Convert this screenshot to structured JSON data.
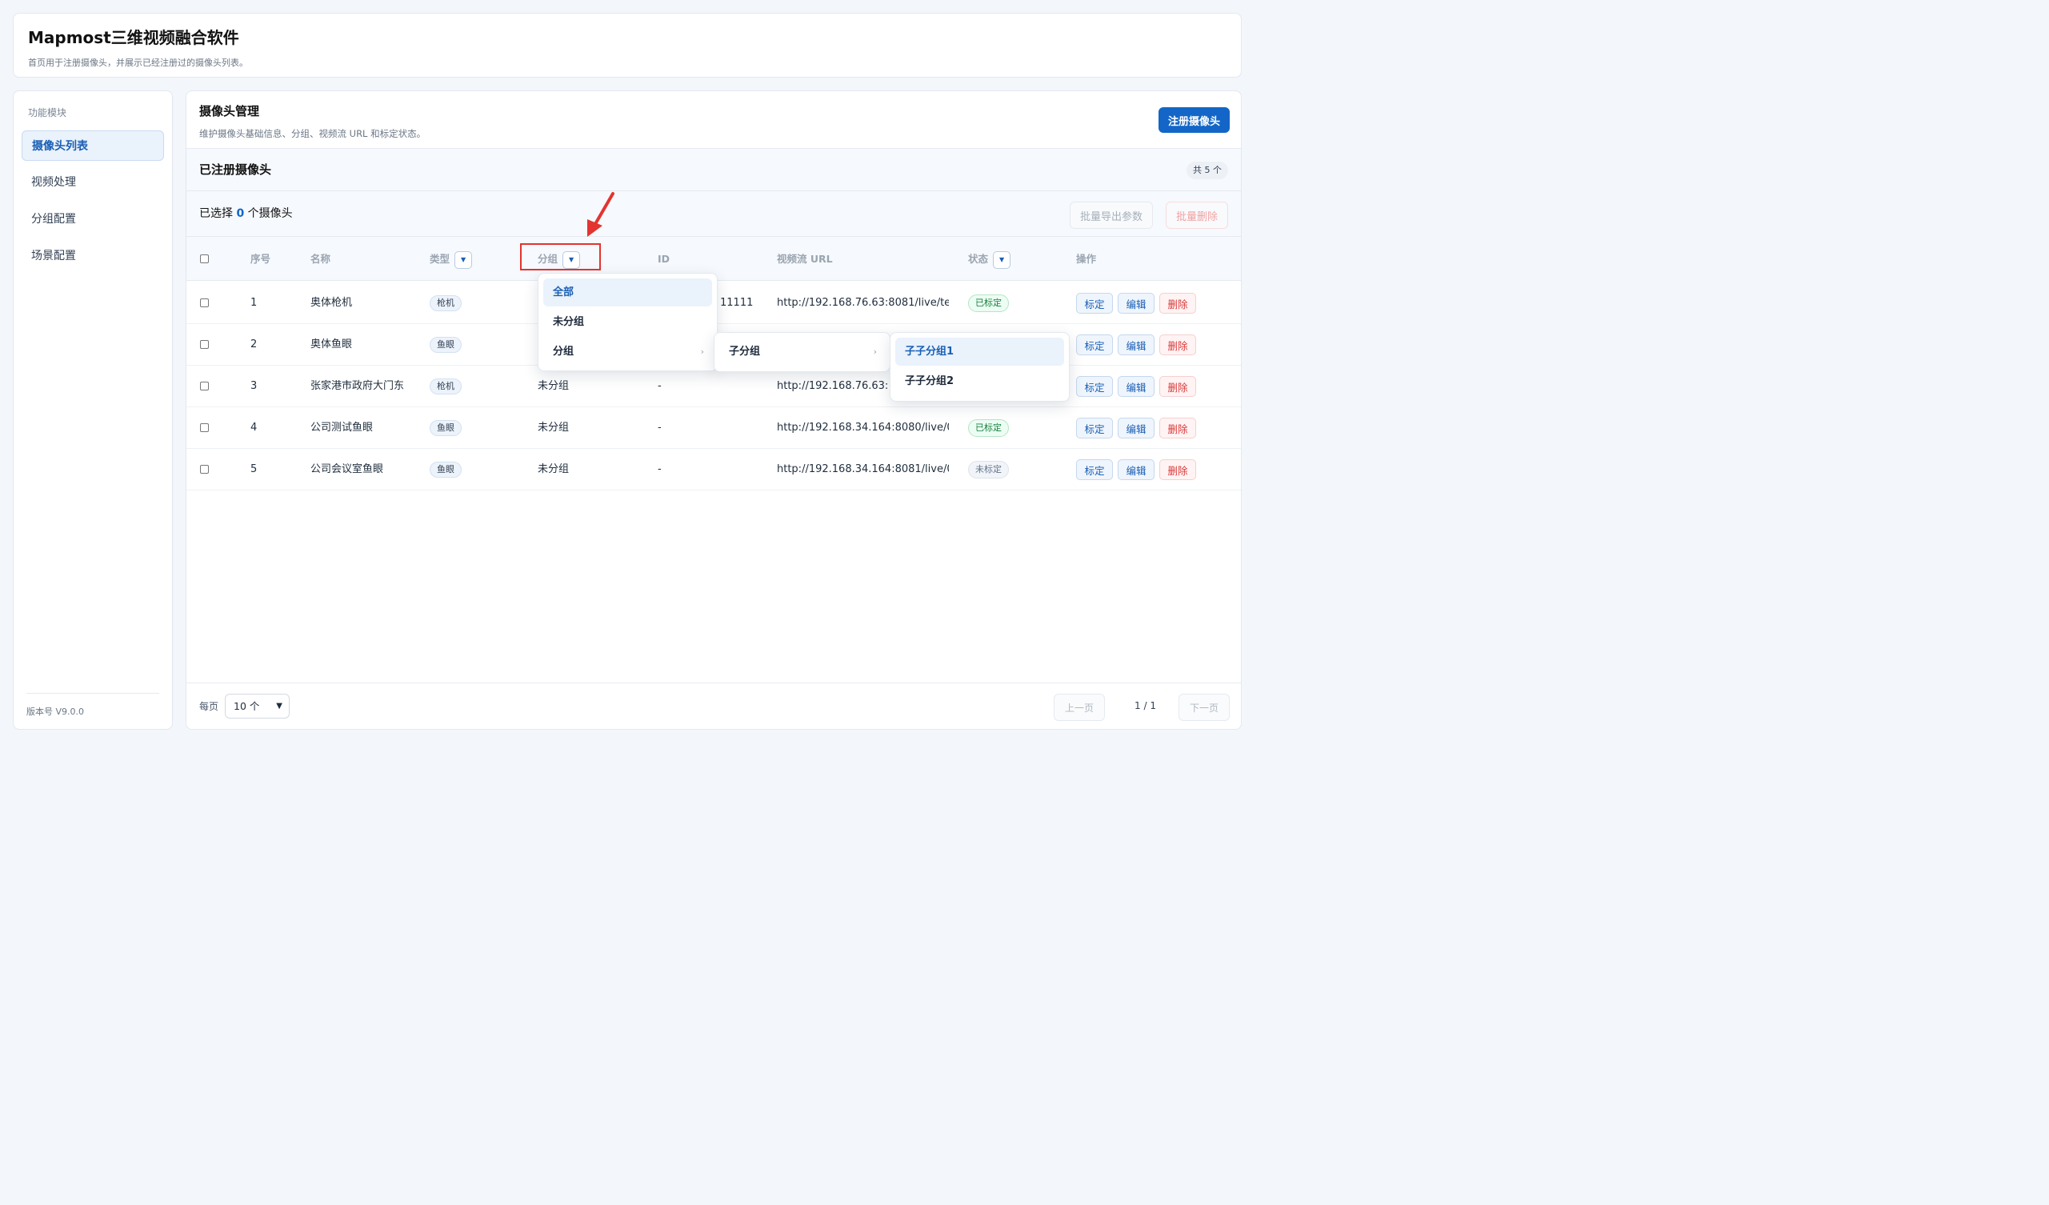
{
  "app": {
    "title": "Mapmost三维视频融合软件",
    "subtitle": "首页用于注册摄像头，并展示已经注册过的摄像头列表。"
  },
  "sidebar": {
    "title": "功能模块",
    "items": [
      {
        "label": "摄像头列表"
      },
      {
        "label": "视频处理"
      },
      {
        "label": "分组配置"
      },
      {
        "label": "场景配置"
      }
    ],
    "version": "版本号 V9.0.0"
  },
  "panel": {
    "title": "摄像头管理",
    "description": "维护摄像头基础信息、分组、视频流 URL 和标定状态。",
    "register_button": "注册摄像头"
  },
  "list": {
    "title": "已注册摄像头",
    "total": "共 5 个",
    "selected_prefix": "已选择",
    "selected_count": "0",
    "selected_suffix": "个摄像头",
    "export_button": "批量导出参数",
    "batch_delete_button": "批量删除"
  },
  "table": {
    "headers": {
      "index": "序号",
      "name": "名称",
      "type": "类型",
      "group": "分组",
      "id": "ID",
      "url": "视频流 URL",
      "status": "状态",
      "actions": "操作"
    },
    "action_labels": {
      "calibrate": "标定",
      "edit": "编辑",
      "delete": "删除"
    },
    "rows": [
      {
        "index": "1",
        "name": "奥体枪机",
        "type": "枪机",
        "group": "",
        "id": "11111",
        "url": "http://192.168.76.63:8081/live/te…",
        "status": "已标定",
        "status_kind": "ok"
      },
      {
        "index": "2",
        "name": "奥体鱼眼",
        "type": "鱼眼",
        "group": "",
        "id": "",
        "url": "",
        "status": "",
        "status_kind": "none"
      },
      {
        "index": "3",
        "name": "张家港市政府大门东",
        "type": "枪机",
        "group": "未分组",
        "id": "-",
        "url": "http://192.168.76.63:808",
        "status": "",
        "status_kind": "none"
      },
      {
        "index": "4",
        "name": "公司测试鱼眼",
        "type": "鱼眼",
        "group": "未分组",
        "id": "-",
        "url": "http://192.168.34.164:8080/live/0…",
        "status": "已标定",
        "status_kind": "ok"
      },
      {
        "index": "5",
        "name": "公司会议室鱼眼",
        "type": "鱼眼",
        "group": "未分组",
        "id": "-",
        "url": "http://192.168.34.164:8081/live/0…",
        "status": "未标定",
        "status_kind": "no"
      }
    ]
  },
  "group_menu": {
    "level1": [
      {
        "label": "全部"
      },
      {
        "label": "未分组"
      },
      {
        "label": "分组",
        "arrow": "›"
      }
    ],
    "level2": [
      {
        "label": "子分组",
        "arrow": "›"
      }
    ],
    "level3": [
      {
        "label": "子子分组1"
      },
      {
        "label": "子子分组2"
      }
    ]
  },
  "pagination": {
    "per_page_label": "每页",
    "per_page_value": "10 个",
    "prev": "上一页",
    "page": "1 / 1",
    "next": "下一页"
  },
  "colors": {
    "accent": "#1366c7",
    "danger": "#d93b3b",
    "success": "#15803d",
    "annotation": "#e3342f"
  },
  "icons": {
    "filter": "caret-down-icon",
    "submenu": "chevron-right-icon",
    "select": "chevron-down-icon",
    "annotation": "red-arrow-icon"
  }
}
